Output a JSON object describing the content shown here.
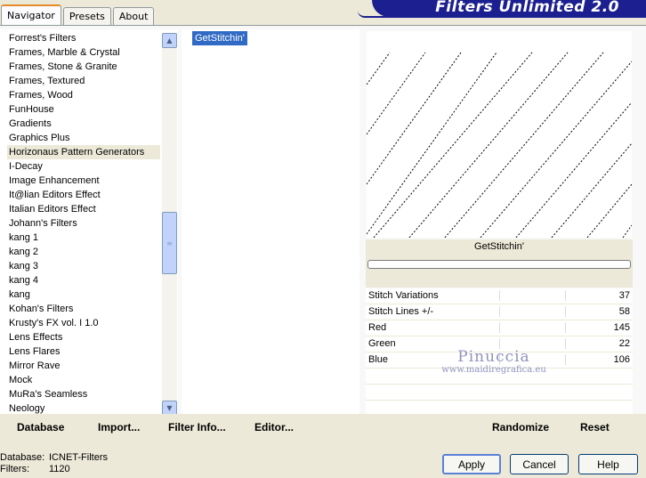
{
  "tabs": [
    "Navigator",
    "Presets",
    "About"
  ],
  "banner_title": "Filters Unlimited 2.0",
  "categories": [
    "Forrest's Filters",
    "Frames, Marble & Crystal",
    "Frames, Stone & Granite",
    "Frames, Textured",
    "Frames, Wood",
    "FunHouse",
    "Gradients",
    "Graphics Plus",
    "Horizonaus Pattern Generators",
    "I-Decay",
    "Image Enhancement",
    "It@lian Editors Effect",
    "Italian Editors Effect",
    "Johann's Filters",
    "kang 1",
    "kang 2",
    "kang 3",
    "kang 4",
    "kang",
    "Kohan's Filters",
    "Krusty's FX vol. I 1.0",
    "Lens Effects",
    "Lens Flares",
    "Mirror Rave",
    "Mock",
    "MuRa's Seamless",
    "Neology"
  ],
  "selected_category": "Horizonaus Pattern Generators",
  "scrollbar": {
    "up_icon": "up-arrow-icon",
    "down_icon": "down-arrow-icon",
    "grip_icon": "grip-icon"
  },
  "filters": [
    "GetStitchin'"
  ],
  "selected_filter": "GetStitchin'",
  "preview": {
    "filter_name": "GetStitchin'"
  },
  "params": [
    {
      "label": "Stitch Variations",
      "value": "37"
    },
    {
      "label": "Stitch Lines +/-",
      "value": "58"
    },
    {
      "label": "Red",
      "value": "145"
    },
    {
      "label": "Green",
      "value": "22"
    },
    {
      "label": "Blue",
      "value": "106"
    }
  ],
  "watermark": {
    "name": "Pinuccia",
    "url": "www.maidiregrafica.eu"
  },
  "commands": {
    "database": "Database",
    "import": "Import...",
    "filter_info": "Filter Info...",
    "editor": "Editor...",
    "randomize": "Randomize",
    "reset": "Reset"
  },
  "status": {
    "database_label": "Database:",
    "database_value": "ICNET-Filters",
    "filters_label": "Filters:",
    "filters_value": "1120"
  },
  "buttons": {
    "apply": "Apply",
    "cancel": "Cancel",
    "help": "Help"
  },
  "colors": {
    "banner": "#1c1f8f",
    "selection": "#316ac5",
    "active_tab": "#e68b2c"
  }
}
